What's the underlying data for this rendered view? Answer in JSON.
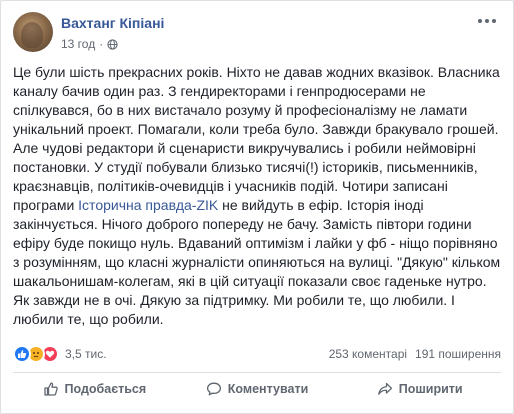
{
  "post": {
    "author": "Вахтанг Кіпіані",
    "time": "13 год",
    "privacy_icon": "globe-icon",
    "text_before_link": "Це були шість прекрасних років. Ніхто не давав жодних вказівок. Власника каналу бачив один раз. З гендиректорами і генпродюсерами не спілкувався, бо в них вистачало розуму й професіоналізму не ламати унікальний проект. Помагали, коли треба було. Завжди бракувало грошей. Але чудові редактори й сценаристи викручувались і робили неймовірні постановки. У студії побували близько тисячі(!) істориків, письменників, краєзнавців, політиків-очевидців і учасників подій. Чотири записані програми ",
    "link_text": "Історична правда-ZIK",
    "text_after_link": " не вийдуть в ефір. Історія іноді закінчується. Нічого доброго попереду не бачу. Замість півтори години ефіру буде покищо нуль. Вдаваний оптимізм і лайки у фб - ніщо порівняно з розумінням, що класні журналісти опиняються на вулиці. \"Дякую\" кільком шакальонишам-колегам, які в цій ситуації показали своє гаденьке нутро. Як завжди не в очі. Дякую за підтримку. Ми робили те, що любили. І любили те, що робили."
  },
  "stats": {
    "reactions_count": "3,5 тис.",
    "comments": "253 коментарі",
    "shares": "191 поширення"
  },
  "actions": {
    "like": "Подобається",
    "comment": "Коментувати",
    "share": "Поширити"
  },
  "colors": {
    "link": "#385898",
    "like_reaction": "#2078f4",
    "sad_reaction": "#f7b125",
    "love_reaction": "#f33e58"
  }
}
